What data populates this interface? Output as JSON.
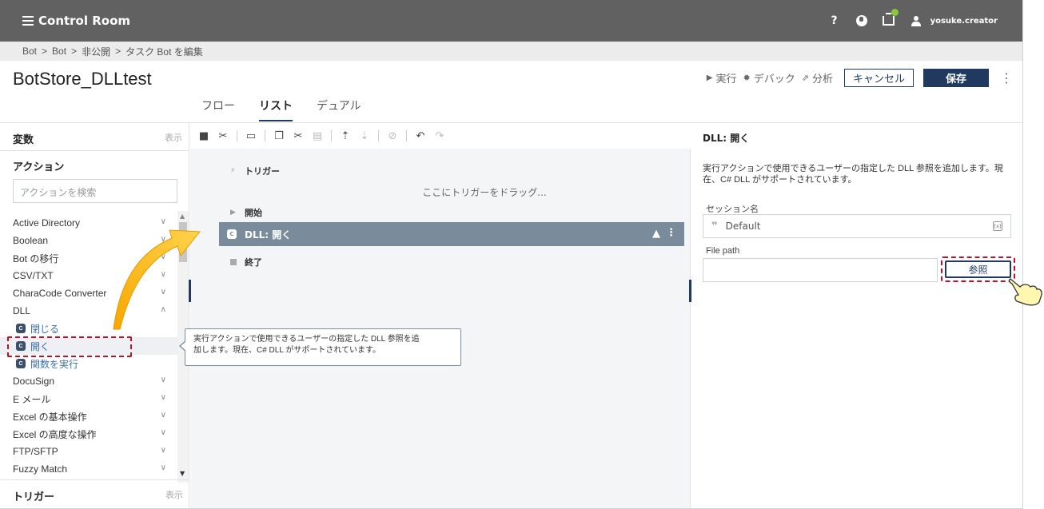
{
  "topbar": {
    "brand": "Control Room",
    "help_label": "?",
    "username": "yosuke.creator"
  },
  "breadcrumb": [
    "Bot",
    "Bot",
    "非公開",
    "タスク Bot を編集"
  ],
  "breadcrumb_sep": ">",
  "title": "BotStore_DLLtest",
  "header_actions": {
    "run": "実行",
    "debug": "デバック",
    "analyze": "分析",
    "cancel": "キャンセル",
    "save": "保存"
  },
  "tabs": [
    {
      "label": "フロー",
      "active": false
    },
    {
      "label": "リスト",
      "active": true
    },
    {
      "label": "デュアル",
      "active": false
    }
  ],
  "left_panel": {
    "variables_title": "変数",
    "variables_hint": "表示",
    "actions_title": "アクション",
    "search_placeholder": "アクションを検索",
    "items": [
      "Active Directory",
      "Boolean",
      "Bot の移行",
      "CSV/TXT",
      "CharaCode Converter",
      "DLL"
    ],
    "dll_children": [
      "閉じる",
      "開く",
      "関数を実行"
    ],
    "items_after": [
      "DocuSign",
      "E メール",
      "Excel の基本操作",
      "Excel の高度な操作",
      "FTP/SFTP",
      "Fuzzy Match"
    ],
    "triggers_title": "トリガー",
    "triggers_hint": "表示"
  },
  "flow": {
    "trigger_label": "トリガー",
    "drop_hint": "ここにトリガーをドラッグ...",
    "start_label": "開始",
    "dll_step": "DLL: 開く",
    "end_label": "終了"
  },
  "tooltip": {
    "line1": "実行アクションで使用できるユーザーの指定した DLL 参照を追",
    "line2": "加します。現在、C# DLL がサポートされています。"
  },
  "right_panel": {
    "title": "DLL: 開く",
    "desc": "実行アクションで使用できるユーザーの指定した DLL 参照を追加します。現在、C# DLL がサポートされています。",
    "session_label": "セッション名",
    "session_value": "Default",
    "filepath_label": "File path",
    "filepath_value": "",
    "browse_label": "参照"
  },
  "colors": {
    "topbar": "#616161",
    "accent": "#1f3a5e",
    "selected_step": "#7a8c9c",
    "annotation": "#c0102a",
    "arrow": "#f6a800"
  }
}
